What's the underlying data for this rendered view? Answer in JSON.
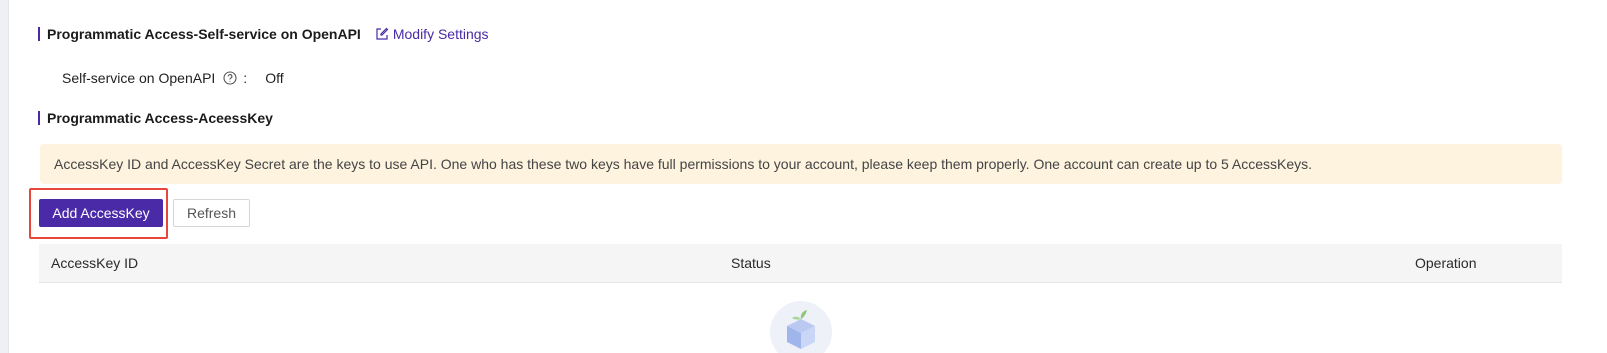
{
  "openapi_section": {
    "title": "Programmatic Access-Self-service on OpenAPI",
    "modify_label": "Modify Settings",
    "field_label": "Self-service on OpenAPI",
    "separator": ":",
    "field_value": "Off"
  },
  "accesskey_section": {
    "title": "Programmatic Access-AceessKey",
    "notice": "AccessKey ID and AccessKey Secret are the keys to use API. One who has these two keys have full permissions to your account, please keep them properly. One account can create up to 5 AccessKeys.",
    "add_button": "Add AccessKey",
    "refresh_button": "Refresh"
  },
  "table": {
    "columns": [
      "AccessKey ID",
      "Status",
      "Operation"
    ]
  },
  "colors": {
    "accent": "#4b2aa7",
    "notice_bg": "#fdf3df",
    "highlight_border": "#e6463c"
  },
  "icons": {
    "modify": "edit-icon",
    "help": "question-circle-icon",
    "empty": "empty-box-icon"
  }
}
